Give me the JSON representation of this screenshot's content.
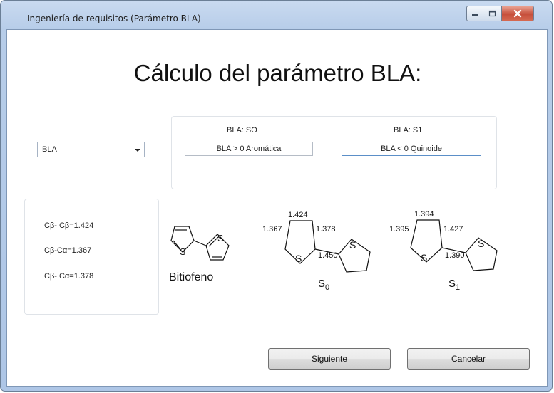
{
  "window": {
    "title": "Ingeniería de requisitos (Parámetro BLA)",
    "controls": {
      "minimize": "minimize-icon",
      "maximize": "maximize-icon",
      "close": "close-icon"
    }
  },
  "heading": "Cálculo del parámetro BLA:",
  "selector": {
    "value": "BLA"
  },
  "bla_panel": {
    "s0": {
      "label": "BLA: SO",
      "value": "BLA > 0 Aromática"
    },
    "s1": {
      "label": "BLA: S1",
      "value": "BLA < 0 Quinoide"
    }
  },
  "bonds": [
    {
      "text": "Cβ- Cβ=1.424"
    },
    {
      "text": "Cβ-Cα=1.367"
    },
    {
      "text": "Cβ- Cα=1.378"
    }
  ],
  "molecules": {
    "bitiofeno": {
      "name": "Bitiofeno",
      "atom": "S"
    },
    "s0": {
      "atom": "S",
      "state": "S",
      "sub": "0",
      "bonds": [
        "1.424",
        "1.367",
        "1.378",
        "1.450"
      ]
    },
    "s1": {
      "atom": "S",
      "state": "S",
      "sub": "1",
      "bonds": [
        "1.394",
        "1.395",
        "1.427",
        "1.390"
      ]
    }
  },
  "buttons": {
    "next": "Siguiente",
    "cancel": "Cancelar"
  }
}
